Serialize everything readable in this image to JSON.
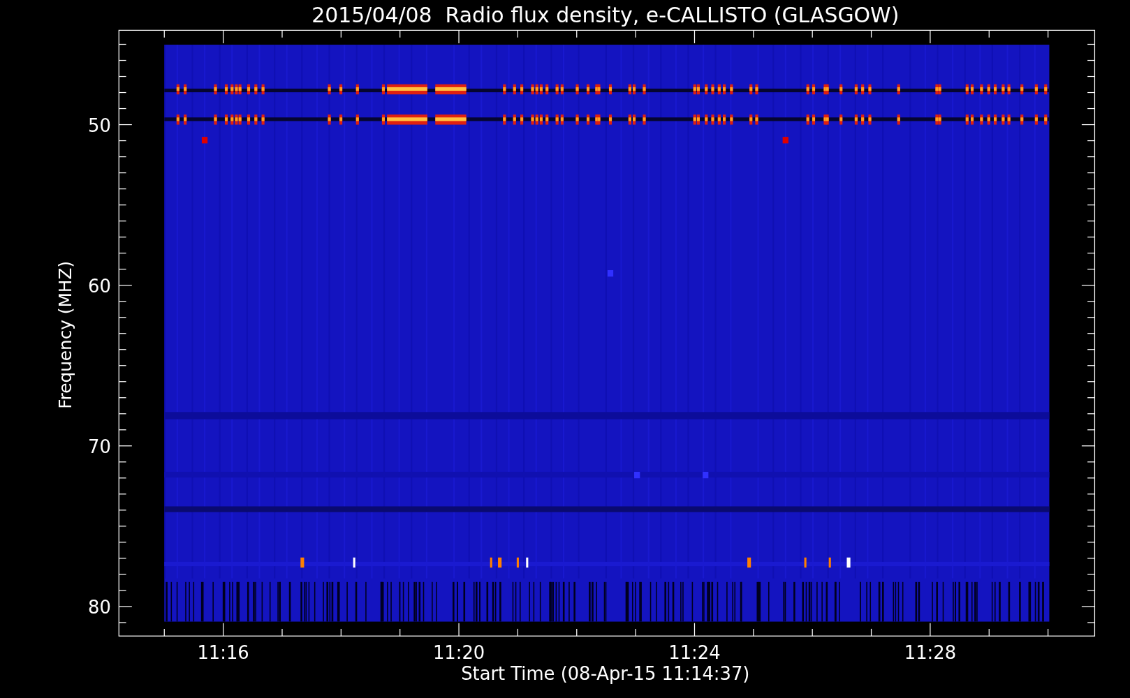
{
  "title": "2015/04/08  Radio flux density, e-CALLISTO (GLASGOW)",
  "y_axis": {
    "label": "Frequency (MHZ)",
    "ticks": [
      "50",
      "60",
      "70",
      "80"
    ]
  },
  "x_axis": {
    "label": "Start Time (08-Apr-15 11:14:37)",
    "ticks": [
      "11:16",
      "11:20",
      "11:24",
      "11:28"
    ]
  }
}
